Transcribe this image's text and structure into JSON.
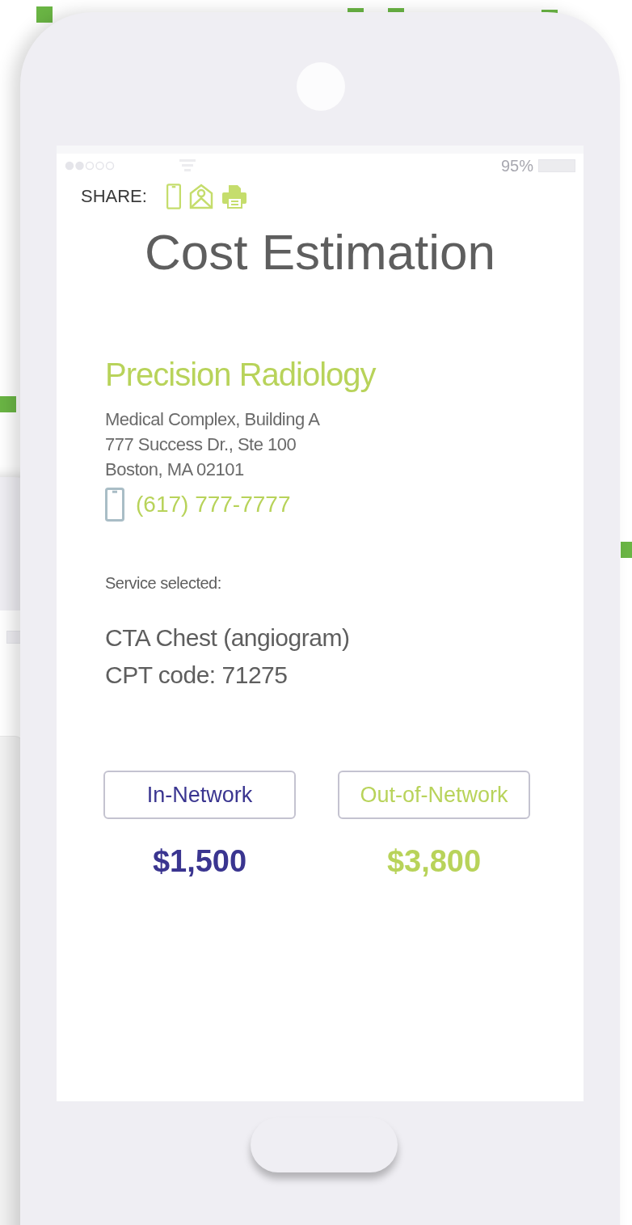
{
  "status_bar": {
    "battery": "95%"
  },
  "share": {
    "label": "SHARE:"
  },
  "title": "Cost Estimation",
  "provider": {
    "name": "Precision Radiology",
    "address": [
      "Medical Complex, Building A",
      "777 Success Dr., Ste 100",
      "Boston, MA 02101"
    ],
    "phone": "(617) 777-7777"
  },
  "service": {
    "label": "Service selected:",
    "lines": [
      "CTA Chest (angiogram)",
      "CPT code: 71275"
    ]
  },
  "networks": [
    {
      "label": "In-Network",
      "price": "$1,500",
      "color": "#3a3590"
    },
    {
      "label": "Out-of-Network",
      "price": "$3,800",
      "color": "#b8d35a"
    }
  ]
}
